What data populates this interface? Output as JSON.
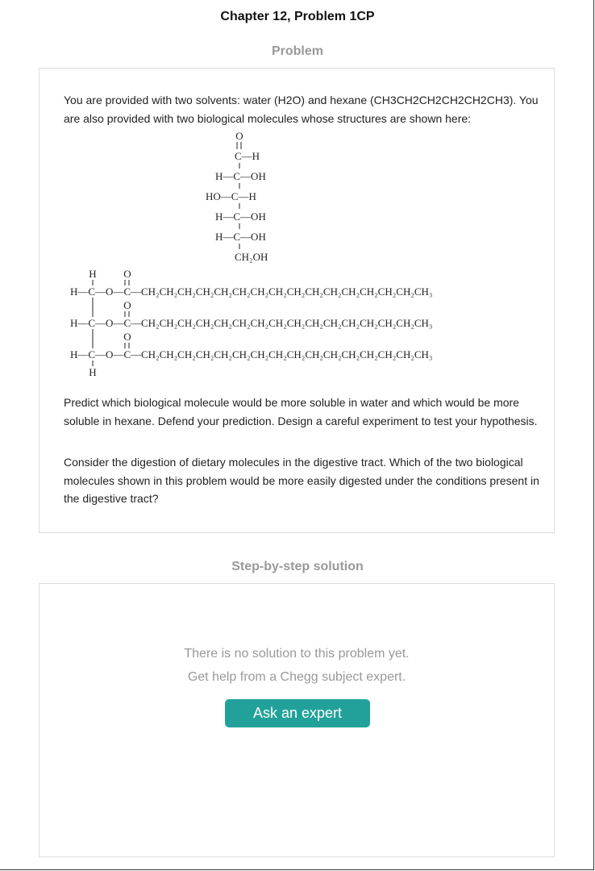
{
  "header": {
    "title": "Chapter 12, Problem 1CP"
  },
  "problem": {
    "label": "Problem",
    "intro": "You are provided with two solvents: water (H2O) and hexane (CH3CH2CH2CH2CH2CH3). You are also provided with two biological molecules whose structures are shown here:",
    "question_1": "Predict which biological molecule would be more soluble in water and which would be more soluble in hexane. Defend your prediction. Design a careful experiment to test your hypothesis.",
    "question_2": "Consider the digestion of dietary molecules in the digestive tract. Which of the two biological molecules shown in this problem would be more easily digested under the conditions present in the digestive tract?",
    "glucose": {
      "o": "O",
      "c_h": "C—H",
      "row2": "H—C—OH",
      "row3": "HO—C—H",
      "row4": "H—C—OH",
      "row5": "H—C—OH",
      "ch2oh": "CH₂OH"
    },
    "triglyceride": {
      "h": "H",
      "o": "O",
      "glycerol_prefix": "H—C—O—C—",
      "chain": "CH₂CH₂CH₂CH₂CH₂CH₂CH₂CH₂CH₂CH₂CH₂CH₂CH₂CH₂CH₂CH₃"
    }
  },
  "solution": {
    "label": "Step-by-step solution",
    "empty_line_1": "There is no solution to this problem yet.",
    "empty_line_2": "Get help from a Chegg subject expert.",
    "ask_button": "Ask an expert"
  }
}
